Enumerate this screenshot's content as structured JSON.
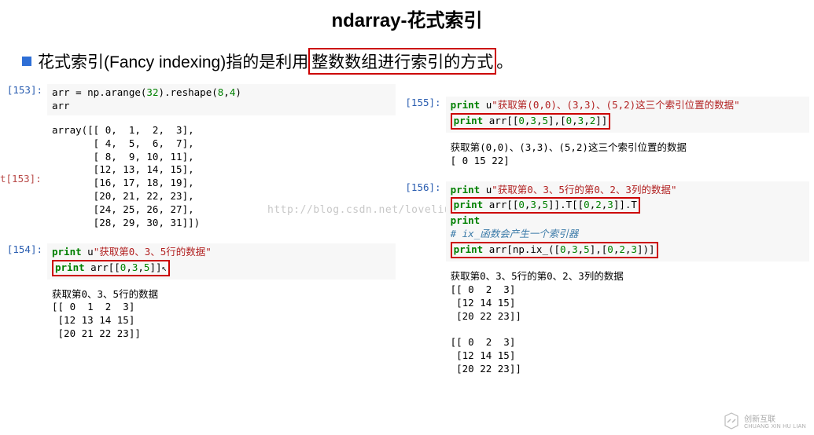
{
  "title": "ndarray-花式索引",
  "bullet": {
    "prefix": "花式索引(Fancy indexing)指的是利用",
    "highlight": "整数数组进行索引的方式",
    "suffix": "。"
  },
  "watermark": "http://blog.csdn.net/loveliuzz",
  "trunc_out": "t[153]:",
  "cells": {
    "c153_in": {
      "prompt": "[153]:",
      "lines": [
        [
          {
            "t": "arr = np.arange("
          },
          {
            "t": "32",
            "c": "num-green"
          },
          {
            "t": ").reshape("
          },
          {
            "t": "8",
            "c": "num-green"
          },
          {
            "t": ","
          },
          {
            "t": "4",
            "c": "num-green"
          },
          {
            "t": ")"
          }
        ],
        [
          {
            "t": "arr"
          }
        ]
      ]
    },
    "c153_out": {
      "prompt": "[153]:",
      "text": "array([[ 0,  1,  2,  3],\n       [ 4,  5,  6,  7],\n       [ 8,  9, 10, 11],\n       [12, 13, 14, 15],\n       [16, 17, 18, 19],\n       [20, 21, 22, 23],\n       [24, 25, 26, 27],\n       [28, 29, 30, 31]])"
    },
    "c154_in": {
      "prompt": "[154]:",
      "line1": [
        {
          "t": "print",
          "c": "kw-green"
        },
        {
          "t": " u"
        },
        {
          "t": "\"获取第0、3、5行的数据\"",
          "c": "str-red"
        }
      ],
      "box": [
        {
          "t": "print",
          "c": "kw-green"
        },
        {
          "t": " arr[["
        },
        {
          "t": "0",
          "c": "num-green"
        },
        {
          "t": ","
        },
        {
          "t": "3",
          "c": "num-green"
        },
        {
          "t": ","
        },
        {
          "t": "5",
          "c": "num-green"
        },
        {
          "t": "]]"
        }
      ],
      "cursor": "↖"
    },
    "c154_out": {
      "text": "获取第0、3、5行的数据\n[[ 0  1  2  3]\n [12 13 14 15]\n [20 21 22 23]]"
    },
    "c155_in": {
      "prompt": "[155]:",
      "line1": [
        {
          "t": "print",
          "c": "kw-green"
        },
        {
          "t": " u"
        },
        {
          "t": "\"获取第(0,0)、(3,3)、(5,2)这三个索引位置的数据\"",
          "c": "str-red"
        }
      ],
      "box": [
        {
          "t": "print",
          "c": "kw-green"
        },
        {
          "t": " arr[["
        },
        {
          "t": "0",
          "c": "num-green"
        },
        {
          "t": ","
        },
        {
          "t": "3",
          "c": "num-green"
        },
        {
          "t": ","
        },
        {
          "t": "5",
          "c": "num-green"
        },
        {
          "t": "],["
        },
        {
          "t": "0",
          "c": "num-green"
        },
        {
          "t": ","
        },
        {
          "t": "3",
          "c": "num-green"
        },
        {
          "t": ","
        },
        {
          "t": "2",
          "c": "num-green"
        },
        {
          "t": "]]"
        }
      ]
    },
    "c155_out": {
      "text": "获取第(0,0)、(3,3)、(5,2)这三个索引位置的数据\n[ 0 15 22]"
    },
    "c156_in": {
      "prompt": "[156]:",
      "line1": [
        {
          "t": "print",
          "c": "kw-green"
        },
        {
          "t": " u"
        },
        {
          "t": "\"获取第0、3、5行的第0、2、3列的数据\"",
          "c": "str-red"
        }
      ],
      "box1": [
        {
          "t": "print",
          "c": "kw-green"
        },
        {
          "t": " arr[["
        },
        {
          "t": "0",
          "c": "num-green"
        },
        {
          "t": ","
        },
        {
          "t": "3",
          "c": "num-green"
        },
        {
          "t": ","
        },
        {
          "t": "5",
          "c": "num-green"
        },
        {
          "t": "]].T[["
        },
        {
          "t": "0",
          "c": "num-green"
        },
        {
          "t": ","
        },
        {
          "t": "2",
          "c": "num-green"
        },
        {
          "t": ","
        },
        {
          "t": "3",
          "c": "num-green"
        },
        {
          "t": "]].T"
        }
      ],
      "line3": [
        {
          "t": "print",
          "c": "kw-green"
        }
      ],
      "comment": [
        {
          "t": "# ix_函数会产生一个索引器",
          "c": "comment-blue"
        }
      ],
      "box2": [
        {
          "t": "print",
          "c": "kw-green"
        },
        {
          "t": " arr[np.ix_(["
        },
        {
          "t": "0",
          "c": "num-green"
        },
        {
          "t": ","
        },
        {
          "t": "3",
          "c": "num-green"
        },
        {
          "t": ","
        },
        {
          "t": "5",
          "c": "num-green"
        },
        {
          "t": "],["
        },
        {
          "t": "0",
          "c": "num-green"
        },
        {
          "t": ","
        },
        {
          "t": "2",
          "c": "num-green"
        },
        {
          "t": ","
        },
        {
          "t": "3",
          "c": "num-green"
        },
        {
          "t": "])]"
        }
      ]
    },
    "c156_out": {
      "text": "获取第0、3、5行的第0、2、3列的数据\n[[ 0  2  3]\n [12 14 15]\n [20 22 23]]\n\n[[ 0  2  3]\n [12 14 15]\n [20 22 23]]"
    }
  },
  "footer": {
    "brand": "创新互联",
    "sub": "CHUANG XIN HU LIAN"
  }
}
